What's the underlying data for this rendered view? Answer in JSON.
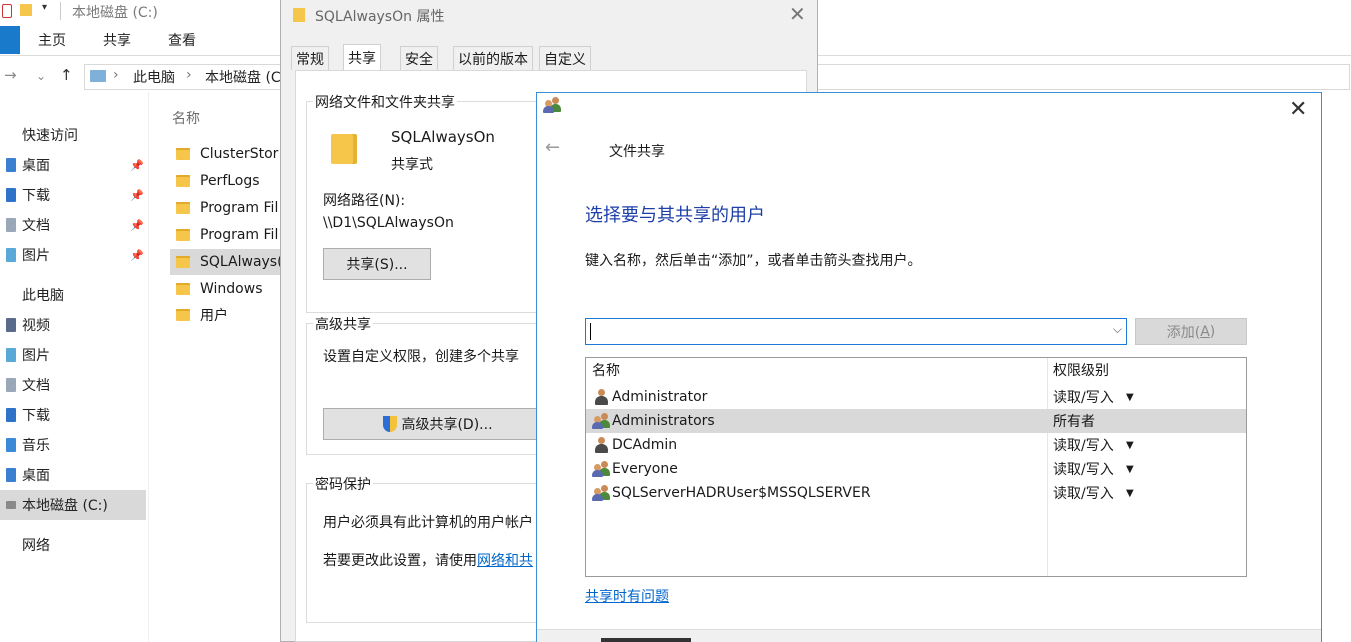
{
  "explorer": {
    "title": "本地磁盘 (C:)",
    "ribbon_tabs": [
      "主页",
      "共享",
      "查看"
    ],
    "breadcrumb": [
      "此电脑",
      "本地磁盘 (C"
    ],
    "sidebar": [
      {
        "label": "快速访问",
        "pinned": false
      },
      {
        "label": "桌面",
        "pinned": true
      },
      {
        "label": "下载",
        "pinned": true
      },
      {
        "label": "文档",
        "pinned": true
      },
      {
        "label": "图片",
        "pinned": true
      },
      {
        "label": "此电脑",
        "pinned": false
      },
      {
        "label": "视频",
        "pinned": false
      },
      {
        "label": "图片",
        "pinned": false
      },
      {
        "label": "文档",
        "pinned": false
      },
      {
        "label": "下载",
        "pinned": false
      },
      {
        "label": "音乐",
        "pinned": false
      },
      {
        "label": "桌面",
        "pinned": false
      },
      {
        "label": "本地磁盘 (C:)",
        "pinned": false
      },
      {
        "label": "网络",
        "pinned": false
      }
    ],
    "column_name": "名称",
    "files": [
      "ClusterStor",
      "PerfLogs",
      "Program Fil",
      "Program Fil",
      "SQLAlways(",
      "Windows",
      "用户"
    ]
  },
  "properties": {
    "title": "SQLAlwaysOn 属性",
    "tabs": [
      "常规",
      "共享",
      "安全",
      "以前的版本",
      "自定义"
    ],
    "share_group_title": "网络文件和文件夹共享",
    "folder_name": "SQLAlwaysOn",
    "folder_state": "共享式",
    "network_path_label": "网络路径(N):",
    "network_path": "\\\\D1\\SQLAlwaysOn",
    "share_button": "共享(S)...",
    "advanced_group_title": "高级共享",
    "advanced_desc": "设置自定义权限，创建多个共享",
    "advanced_button": "高级共享(D)...",
    "password_group_title": "密码保护",
    "password_desc": "用户必须具有此计算机的用户帐户",
    "password_change_prefix": "若要更改此设置，请使用",
    "password_link": "网络和共"
  },
  "wizard": {
    "title": "文件共享",
    "heading": "选择要与其共享的用户",
    "instruction": "键入名称，然后单击“添加”，或者单击箭头查找用户。",
    "input_value": "",
    "add_button_text": "添加(",
    "add_button_key": "A",
    "add_button_close": ")",
    "columns": {
      "name": "名称",
      "permission": "权限级别"
    },
    "users": [
      {
        "name": "Administrator",
        "permission": "读取/写入",
        "icon": "user-icon",
        "dropdown": true,
        "selected": false
      },
      {
        "name": "Administrators",
        "permission": "所有者",
        "icon": "group-icon",
        "dropdown": false,
        "selected": true
      },
      {
        "name": "DCAdmin",
        "permission": "读取/写入",
        "icon": "user-icon",
        "dropdown": true,
        "selected": false
      },
      {
        "name": "Everyone",
        "permission": "读取/写入",
        "icon": "group-icon",
        "dropdown": true,
        "selected": false
      },
      {
        "name": "SQLServerHADRUser$MSSQLSERVER",
        "permission": "读取/写入",
        "icon": "group-icon",
        "dropdown": true,
        "selected": false
      }
    ],
    "help_link": "共享时有问题"
  }
}
